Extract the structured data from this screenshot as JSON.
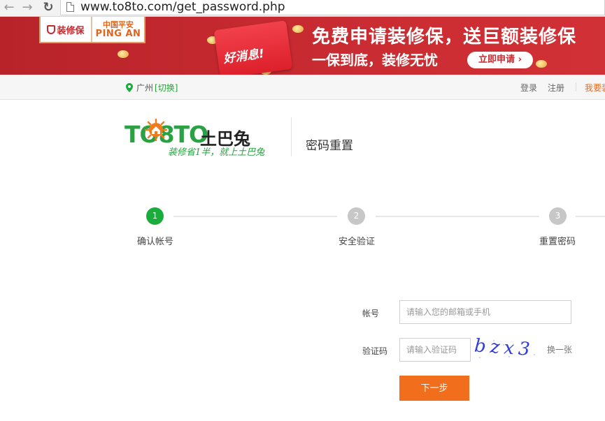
{
  "browser": {
    "url": "www.to8to.com/get_password.php",
    "icons": [
      "back-arrow-icon",
      "forward-arrow-icon",
      "reload-icon",
      "page-icon"
    ]
  },
  "banner": {
    "badge_left": "装修保",
    "badge_right_cn": "中国平安",
    "badge_right_en": "PING AN",
    "envelope_text": "好消息!",
    "title": "免费申请装修保，送巨额装修保",
    "subtitle": "一保到底，装修无忧",
    "apply_button": "立即申请",
    "colors": {
      "background": "#c62a30",
      "accent": "#e2641b"
    }
  },
  "topnav": {
    "city": "广州",
    "switch_label": "[切换]",
    "login": "登录",
    "register": "注册",
    "more": "我要装"
  },
  "logo": {
    "main_text": "TO8TO",
    "cn_text": "土巴兔",
    "slogan": "装修省1半，就上土巴兔"
  },
  "page_title": "密码重置",
  "steps": [
    {
      "number": "1",
      "label": "确认帐号",
      "state": "active"
    },
    {
      "number": "2",
      "label": "安全验证",
      "state": "inactive"
    },
    {
      "number": "3",
      "label": "重置密码",
      "state": "inactive"
    }
  ],
  "form": {
    "account_label": "帐号",
    "account_placeholder": "请输入您的邮箱或手机",
    "captcha_label": "验证码",
    "captcha_placeholder": "请输入验证码",
    "captcha_text": "bzx3",
    "refresh_label": "换一张",
    "next_button": "下一步"
  },
  "colors": {
    "green": "#1aad3c",
    "orange": "#f16e1d"
  }
}
